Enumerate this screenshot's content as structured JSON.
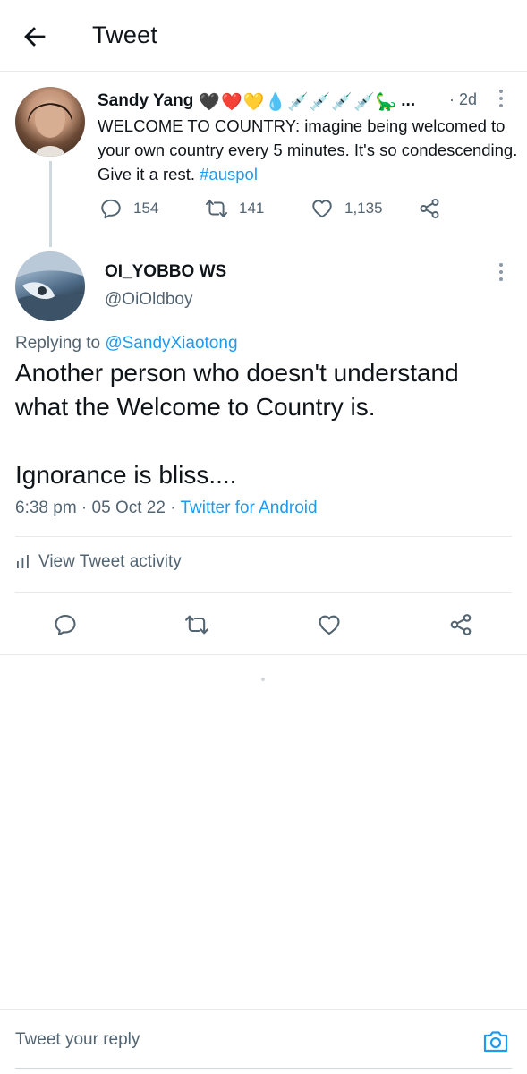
{
  "header": {
    "title": "Tweet"
  },
  "parent_tweet": {
    "author_name": "Sandy Yang",
    "name_emojis": "🖤❤️💛💧💉💉💉💉🦕",
    "name_truncation": "...",
    "time": "· 2d",
    "text": "WELCOME TO COUNTRY: imagine being welcomed to your own country every 5 minutes. It's so condescending. Give it a rest.",
    "hashtag": "#auspol",
    "replies": "154",
    "retweets": "141",
    "likes": "1,135"
  },
  "main_tweet": {
    "author_name": "OI_YOBBO WS",
    "handle": "@OiOldboy",
    "replying_prefix": "Replying to",
    "replying_to": "@SandyXiaotong",
    "text_line1": "Another person who doesn't understand what the Welcome to Country is.",
    "text_line2": "Ignorance is bliss....",
    "timestamp": "6:38 pm · 05 Oct 22 ·",
    "source": "Twitter for Android",
    "activity_label": "View Tweet activity"
  },
  "reply_bar": {
    "placeholder": "Tweet your reply"
  },
  "colors": {
    "accent": "#1d9bf0",
    "secondary_text": "#536471",
    "divider": "#e7e9eb"
  },
  "icons": {
    "back": "arrow-left-icon",
    "more": "more-vertical-icon",
    "reply": "reply-icon",
    "retweet": "retweet-icon",
    "like": "heart-icon",
    "share": "share-icon",
    "activity": "bar-chart-icon",
    "camera": "camera-icon"
  }
}
